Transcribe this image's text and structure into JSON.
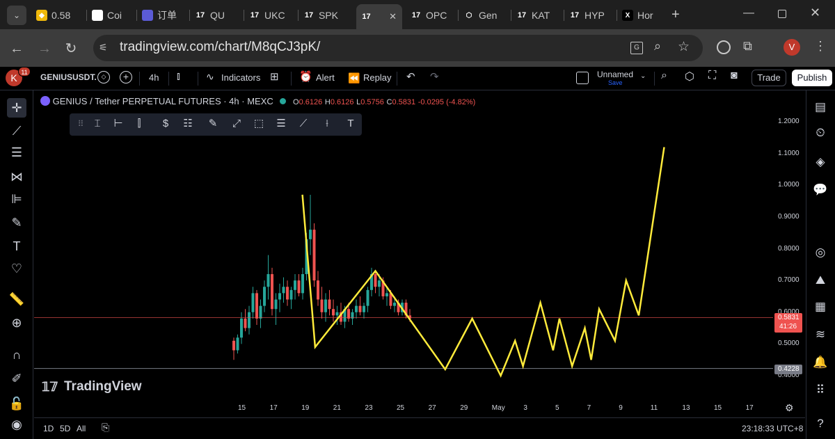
{
  "browser": {
    "tabs": [
      {
        "label": "0.58",
        "icon": "binance-icon"
      },
      {
        "label": "Coi",
        "icon": "coin-icon"
      },
      {
        "label": "订单",
        "icon": "app-icon"
      },
      {
        "label": "QU",
        "icon": "tradingview-icon"
      },
      {
        "label": "UKC",
        "icon": "tradingview-icon"
      },
      {
        "label": "SPK",
        "icon": "tradingview-icon"
      },
      {
        "label": "",
        "icon": "tradingview-icon"
      },
      {
        "label": "OPC",
        "icon": "tradingview-icon"
      },
      {
        "label": "Gen",
        "icon": "fox-icon"
      },
      {
        "label": "KAT",
        "icon": "tradingview-icon"
      },
      {
        "label": "HYP",
        "icon": "tradingview-icon"
      },
      {
        "label": "Hor",
        "icon": "x-icon"
      }
    ],
    "url": "tradingview.com/chart/M8qCJ3pK/",
    "profile_initial": "V"
  },
  "toolbar": {
    "avatar_letter": "K",
    "notif_count": "11",
    "symbol": "GENIUSUSDT.",
    "interval": "4h",
    "indicators_label": "Indicators",
    "alert_label": "Alert",
    "replay_label": "Replay",
    "layout_name": "Unnamed",
    "save_label": "Save",
    "trade_label": "Trade",
    "publish_label": "Publish"
  },
  "legend": {
    "title": "GENIUS / Tether PERPETUAL FUTURES · 4h · MEXC",
    "o_label": "O",
    "o_value": "0.6126",
    "h_label": "H",
    "h_value": "0.6126",
    "l_label": "L",
    "l_value": "0.5756",
    "c_label": "C",
    "c_value": "0.5831",
    "change": "-0.0295 (-4.82%)"
  },
  "price_axis": {
    "labels": [
      "1.2000",
      "1.1000",
      "1.0000",
      "0.9000",
      "0.8000",
      "0.7000",
      "0.6000",
      "0.5000",
      "0.4000"
    ],
    "current_price": "0.5831",
    "countdown": "41:26",
    "low_marker": "0.4228"
  },
  "time_axis": {
    "labels": [
      "15",
      "17",
      "19",
      "21",
      "23",
      "25",
      "27",
      "29",
      "May",
      "3",
      "5",
      "7",
      "9",
      "11",
      "13",
      "15",
      "17"
    ]
  },
  "watermark": "TradingView",
  "bottom": {
    "ranges": [
      "1D",
      "5D",
      "All"
    ],
    "clock": "23:18:33 UTC+8"
  },
  "colors": {
    "up": "#26a69a",
    "down": "#ef5350",
    "drawing": "#ffeb3b",
    "accent": "#2962ff"
  },
  "chart_data": {
    "type": "line",
    "title": "GENIUS / Tether PERPETUAL FUTURES · 4h · MEXC",
    "ylim": [
      0.38,
      1.27
    ],
    "y_ticks": [
      1.2,
      1.1,
      1.0,
      0.9,
      0.8,
      0.7,
      0.6,
      0.5,
      0.4
    ],
    "x_ticks": [
      "15",
      "17",
      "19",
      "21",
      "23",
      "25",
      "27",
      "29",
      "May",
      "3",
      "5",
      "7",
      "9",
      "11",
      "13",
      "15",
      "17"
    ],
    "current_price": 0.5831,
    "low_marker": 0.4228,
    "series": [
      {
        "kind": "projection_path",
        "points": [
          {
            "date": "Apr 18.8",
            "value": 0.97
          },
          {
            "date": "Apr 19.6",
            "value": 0.49
          },
          {
            "date": "Apr 23.4",
            "value": 0.73
          },
          {
            "date": "Apr 27.8",
            "value": 0.42
          },
          {
            "date": "Apr 29.5",
            "value": 0.58
          },
          {
            "date": "May 1.3",
            "value": 0.4
          },
          {
            "date": "May 2.2",
            "value": 0.51
          },
          {
            "date": "May 2.7",
            "value": 0.43
          },
          {
            "date": "May 3.8",
            "value": 0.63
          },
          {
            "date": "May 4.6",
            "value": 0.48
          },
          {
            "date": "May 5.0",
            "value": 0.58
          },
          {
            "date": "May 5.8",
            "value": 0.43
          },
          {
            "date": "May 6.6",
            "value": 0.55
          },
          {
            "date": "May 7.0",
            "value": 0.45
          },
          {
            "date": "May 7.5",
            "value": 0.61
          },
          {
            "date": "May 8.5",
            "value": 0.51
          },
          {
            "date": "May 9.2",
            "value": 0.7
          },
          {
            "date": "May 10.0",
            "value": 0.59
          },
          {
            "date": "May 11.6",
            "value": 1.12
          }
        ]
      },
      {
        "kind": "candles",
        "candles": [
          [
            0.51,
            0.52,
            0.45,
            0.48
          ],
          [
            0.48,
            0.53,
            0.47,
            0.52
          ],
          [
            0.52,
            0.6,
            0.5,
            0.58
          ],
          [
            0.58,
            0.61,
            0.54,
            0.55
          ],
          [
            0.55,
            0.62,
            0.53,
            0.6
          ],
          [
            0.6,
            0.68,
            0.58,
            0.66
          ],
          [
            0.66,
            0.67,
            0.56,
            0.58
          ],
          [
            0.58,
            0.64,
            0.55,
            0.62
          ],
          [
            0.62,
            0.7,
            0.6,
            0.68
          ],
          [
            0.68,
            0.78,
            0.64,
            0.72
          ],
          [
            0.72,
            0.74,
            0.59,
            0.61
          ],
          [
            0.61,
            0.66,
            0.56,
            0.64
          ],
          [
            0.64,
            0.69,
            0.6,
            0.66
          ],
          [
            0.66,
            0.71,
            0.63,
            0.68
          ],
          [
            0.68,
            0.7,
            0.62,
            0.64
          ],
          [
            0.64,
            0.68,
            0.61,
            0.67
          ],
          [
            0.67,
            0.72,
            0.64,
            0.7
          ],
          [
            0.7,
            0.72,
            0.65,
            0.66
          ],
          [
            0.66,
            0.74,
            0.64,
            0.72
          ],
          [
            0.72,
            0.85,
            0.7,
            0.83
          ],
          [
            0.83,
            0.97,
            0.78,
            0.86
          ],
          [
            0.86,
            0.88,
            0.68,
            0.7
          ],
          [
            0.7,
            0.73,
            0.62,
            0.64
          ],
          [
            0.64,
            0.68,
            0.58,
            0.6
          ],
          [
            0.6,
            0.66,
            0.57,
            0.64
          ],
          [
            0.64,
            0.67,
            0.59,
            0.61
          ],
          [
            0.61,
            0.64,
            0.57,
            0.59
          ],
          [
            0.59,
            0.62,
            0.56,
            0.6
          ],
          [
            0.6,
            0.63,
            0.56,
            0.57
          ],
          [
            0.57,
            0.62,
            0.55,
            0.61
          ],
          [
            0.61,
            0.63,
            0.57,
            0.58
          ],
          [
            0.58,
            0.61,
            0.56,
            0.6
          ],
          [
            0.6,
            0.64,
            0.58,
            0.62
          ],
          [
            0.62,
            0.65,
            0.59,
            0.6
          ],
          [
            0.6,
            0.63,
            0.58,
            0.62
          ],
          [
            0.62,
            0.68,
            0.6,
            0.67
          ],
          [
            0.67,
            0.74,
            0.65,
            0.72
          ],
          [
            0.72,
            0.73,
            0.66,
            0.68
          ],
          [
            0.68,
            0.72,
            0.65,
            0.7
          ],
          [
            0.7,
            0.71,
            0.64,
            0.65
          ],
          [
            0.65,
            0.68,
            0.62,
            0.66
          ],
          [
            0.66,
            0.67,
            0.61,
            0.62
          ],
          [
            0.62,
            0.65,
            0.6,
            0.63
          ],
          [
            0.63,
            0.64,
            0.59,
            0.6
          ],
          [
            0.6,
            0.64,
            0.59,
            0.63
          ],
          [
            0.63,
            0.64,
            0.58,
            0.59
          ],
          [
            0.59,
            0.61,
            0.57,
            0.58
          ]
        ]
      }
    ]
  }
}
